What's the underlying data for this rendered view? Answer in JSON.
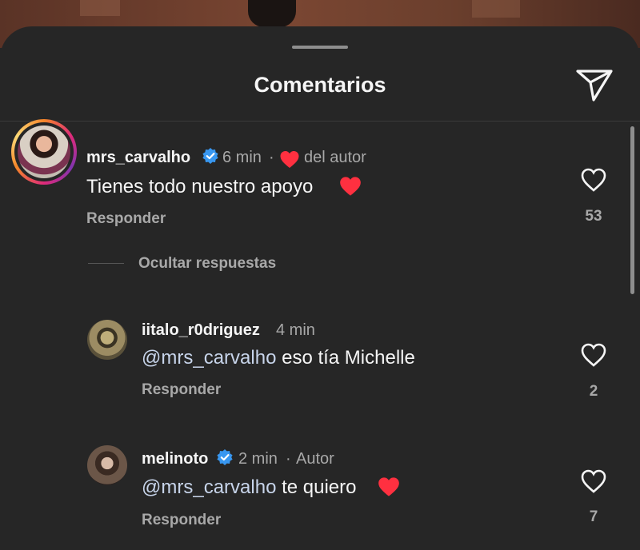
{
  "header": {
    "title": "Comentarios"
  },
  "comments": [
    {
      "username": "mrs_carvalho",
      "verified": true,
      "time": "6 min",
      "author_like": "del autor",
      "text": "Tienes todo nuestro apoyo",
      "emoji": "❤️",
      "reply_label": "Responder",
      "likes": "53"
    }
  ],
  "replies_toggle": "Ocultar respuestas",
  "replies": [
    {
      "username": "iitalo_r0driguez",
      "time": "4 min",
      "mention": "@mrs_carvalho",
      "text": " eso tía Michelle",
      "reply_label": "Responder",
      "likes": "2"
    },
    {
      "username": "melinoto",
      "verified": true,
      "time": "2 min",
      "author_tag": "Autor",
      "mention": "@mrs_carvalho",
      "text": " te quiero",
      "emoji": "❤️",
      "reply_label": "Responder",
      "likes": "7"
    }
  ],
  "colors": {
    "accent_verified": "#3897f0",
    "heart_red": "#ff3040",
    "background": "#262626"
  }
}
